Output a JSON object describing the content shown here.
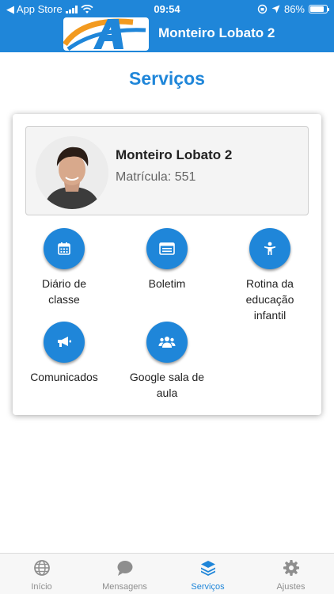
{
  "status_bar": {
    "back_app": "◀ App Store",
    "time": "09:54",
    "battery": "86%",
    "battery_level": 0.86
  },
  "header": {
    "title": "Monteiro Lobato 2",
    "logo_icon": "school-logo"
  },
  "page": {
    "title": "Serviços"
  },
  "profile": {
    "name": "Monteiro Lobato 2",
    "matricula": "Matrícula: 551"
  },
  "services": [
    {
      "label": "Diário de classe",
      "icon": "calendar-icon"
    },
    {
      "label": "Boletim",
      "icon": "report-card-icon"
    },
    {
      "label": "Rotina da educação infantil",
      "icon": "child-icon"
    },
    {
      "label": "Comunicados",
      "icon": "megaphone-icon"
    },
    {
      "label": "Google sala de aula",
      "icon": "users-icon"
    }
  ],
  "tabs": [
    {
      "label": "Início",
      "icon": "globe-icon",
      "active": false
    },
    {
      "label": "Mensagens",
      "icon": "chat-icon",
      "active": false
    },
    {
      "label": "Serviços",
      "icon": "layers-icon",
      "active": true
    },
    {
      "label": "Ajustes",
      "icon": "gear-icon",
      "active": false
    }
  ],
  "colors": {
    "primary": "#1f86d9",
    "inactive_tab": "#8e8e8e"
  }
}
